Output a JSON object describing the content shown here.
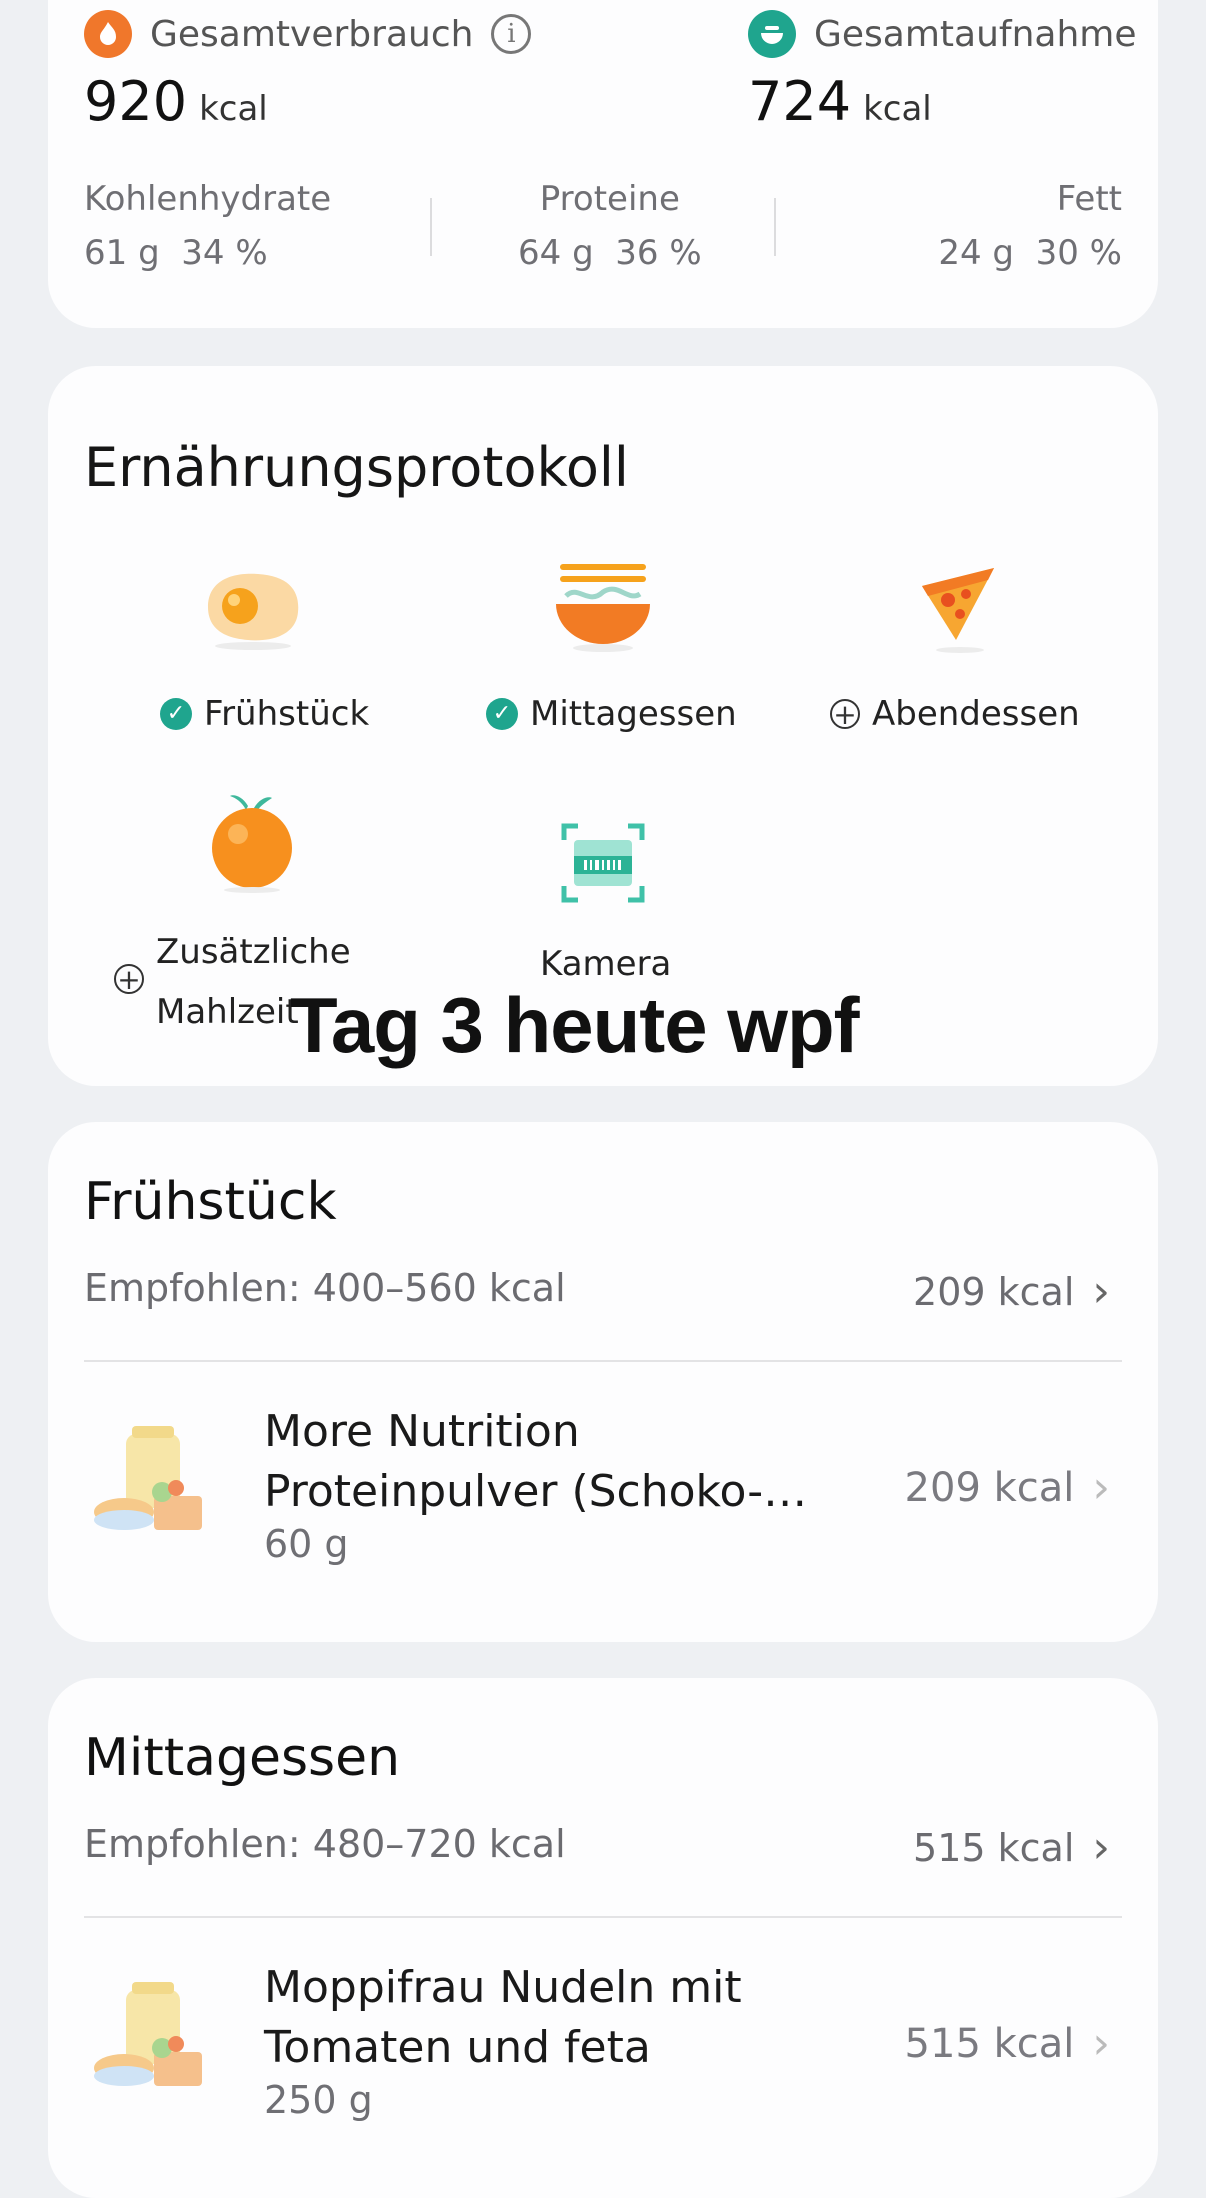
{
  "summary": {
    "burned_label": "Gesamtverbrauch",
    "burned_value": "920",
    "intake_label": "Gesamtaufnahme",
    "intake_value": "724",
    "unit": "kcal",
    "macros": [
      {
        "name": "Kohlenhydrate",
        "grams": "61 g",
        "pct": "34 %"
      },
      {
        "name": "Proteine",
        "grams": "64 g",
        "pct": "36 %"
      },
      {
        "name": "Fett",
        "grams": "24 g",
        "pct": "30 %"
      }
    ]
  },
  "log": {
    "title": "Ernährungsprotokoll",
    "items": [
      {
        "label": "Frühstück",
        "status": "done",
        "icon": "egg-icon"
      },
      {
        "label": "Mittagessen",
        "status": "done",
        "icon": "noodle-bowl-icon"
      },
      {
        "label": "Abendessen",
        "status": "add",
        "icon": "pizza-icon"
      },
      {
        "label_line1": "Zusätzliche",
        "label_line2": "Mahlzeit",
        "status": "add",
        "icon": "orange-icon"
      },
      {
        "label": "Kamera",
        "icon": "barcode-scan-icon"
      }
    ]
  },
  "overlay": "Tag 3 heute wpf",
  "breakfast": {
    "title": "Frühstück",
    "recommended": "Empfohlen: 400–560 kcal",
    "kcal": "209 kcal",
    "food": {
      "name_line1": "More Nutrition",
      "name_line2": "Proteinpulver (Schoko-…",
      "amount": "60 g",
      "kcal": "209 kcal"
    }
  },
  "lunch": {
    "title": "Mittagessen",
    "recommended": "Empfohlen: 480–720 kcal",
    "kcal": "515 kcal",
    "food": {
      "name_line1": "Moppifrau Nudeln mit",
      "name_line2": "Tomaten und feta",
      "amount": "250 g",
      "kcal": "515 kcal"
    }
  },
  "colors": {
    "burned": "#f0772b",
    "intake": "#1fa58e",
    "check": "#1fa58e",
    "background": "#eef0f3",
    "card": "#fdfdfe"
  }
}
